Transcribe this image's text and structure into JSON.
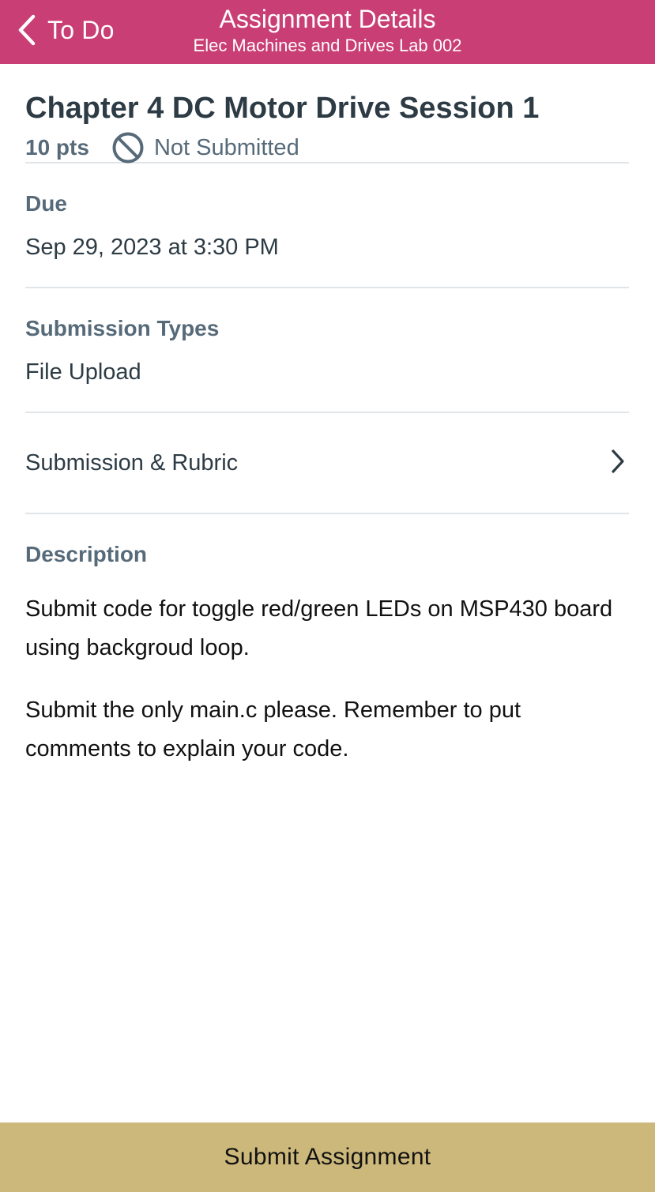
{
  "header": {
    "back_label": "To Do",
    "title": "Assignment Details",
    "subtitle": "Elec Machines and Drives Lab 002",
    "background_color": "#c93e74"
  },
  "assignment": {
    "title": "Chapter 4 DC Motor Drive Session 1",
    "points": "10 pts",
    "status": "Not Submitted",
    "status_icon": "not-submitted-icon"
  },
  "due": {
    "label": "Due",
    "value": "Sep 29, 2023 at 3:30 PM"
  },
  "submission_types": {
    "label": "Submission Types",
    "value": "File Upload"
  },
  "submission_rubric": {
    "label": "Submission & Rubric",
    "icon": "chevron-right-icon"
  },
  "description": {
    "label": "Description",
    "paragraphs": [
      "Submit code for toggle red/green LEDs on MSP430 board using backgroud loop.",
      "Submit the only main.c please. Remember to put comments to explain your code."
    ]
  },
  "footer": {
    "submit_label": "Submit Assignment",
    "button_color": "#cdb87b"
  }
}
